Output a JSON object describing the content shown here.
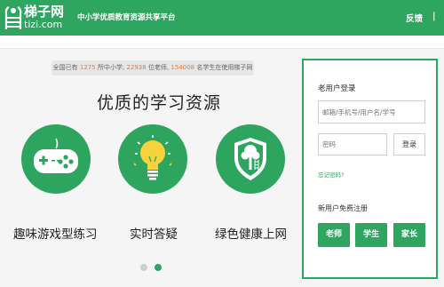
{
  "header": {
    "logo_name": "梯子网",
    "logo_domain": "tizi.com",
    "slogan": "中小学优质教育资源共享平台",
    "feedback": "反馈",
    "topright": "|"
  },
  "stats": {
    "prefix": "全国已有",
    "schools": "1275",
    "schools_suffix": "所中小学,",
    "teachers": "22938",
    "teachers_suffix": "位老师,",
    "students": "154008",
    "students_suffix": "名学生在使用梯子网"
  },
  "main": {
    "title": "优质的学习资源",
    "features": [
      {
        "label": "趣味游戏型练习",
        "icon": "gamepad-icon"
      },
      {
        "label": "实时答疑",
        "icon": "lightbulb-icon"
      },
      {
        "label": "绿色健康上网",
        "icon": "shield-tree-icon"
      }
    ],
    "carousel": {
      "total": 2,
      "active": 2
    }
  },
  "login": {
    "title": "老用户登录",
    "username_placeholder": "邮箱/手机号/用户名/学号",
    "password_placeholder": "密码",
    "login_label": "登录",
    "forgot_label": "忘记密码?",
    "register_title": "新用户免费注册",
    "roles": [
      "老师",
      "学生",
      "家长"
    ]
  },
  "colors": {
    "brand": "#2fa660",
    "accent": "#ef7b2f",
    "bulb": "#f7d23a"
  }
}
